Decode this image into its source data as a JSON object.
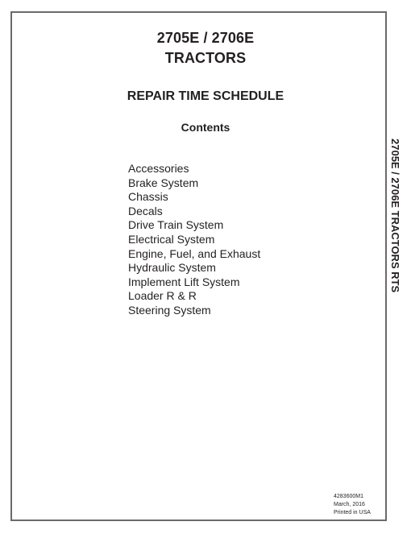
{
  "document": {
    "title_line1": "2705E / 2706E",
    "title_line2": "TRACTORS",
    "subtitle": "REPAIR TIME SCHEDULE",
    "contents_heading": "Contents",
    "contents": [
      "Accessories",
      "Brake System",
      "Chassis",
      "Decals",
      "Drive Train System",
      "Electrical System",
      "Engine, Fuel, and Exhaust",
      "Hydraulic System",
      "Implement Lift System",
      "Loader R & R",
      "Steering System"
    ],
    "spine_text": "2705E / 2706E TRACTORS RTS",
    "footer": {
      "part_number": "4283600M1",
      "date": "March, 2016",
      "printed": "Printed in USA"
    }
  }
}
